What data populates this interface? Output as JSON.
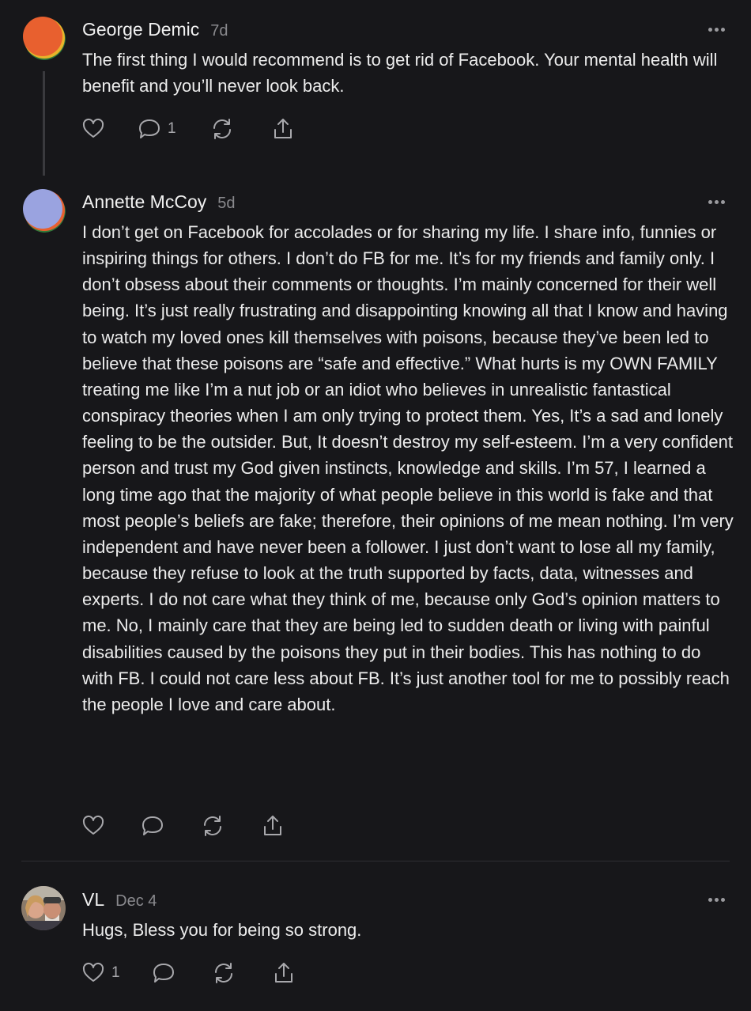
{
  "comments": [
    {
      "author": "George Demic",
      "age": "7d",
      "text": "The first thing I would recommend is to get rid of Facebook. Your mental health will benefit and you’ll never look back.",
      "reply_count": "1"
    },
    {
      "author": "Annette McCoy",
      "age": "5d",
      "text": "I don’t get on Facebook for accolades or for sharing my life. I share info, funnies or inspiring things for others. I don’t do FB for me. It’s for my friends and family only. I don’t obsess about their comments or thoughts. I’m mainly concerned for their well being. It’s just really frustrating and disappointing knowing all that I know and having to watch my loved ones kill themselves with poisons, because they’ve been led to believe that these poisons are “safe and effective.” What hurts is my OWN FAMILY treating me like I’m a nut job or an idiot who believes in unrealistic fantastical conspiracy theories when I am only trying to protect them. Yes, It’s a sad and lonely feeling to be the outsider. But, It doesn’t destroy my self-esteem. I’m a very confident person and trust my God given instincts, knowledge and skills. I’m 57, I learned a long time ago that the majority of what people believe in this world is fake and that most people’s beliefs are fake; therefore, their opinions of me mean nothing. I’m very independent and have never been a follower. I just don’t want to lose all my family, because they refuse to look at the truth supported by facts, data, witnesses and experts. I do not care what they think of me, because only God’s opinion matters to me. No, I mainly care that they are being led to sudden death or living with painful disabilities caused by the poisons they put in their bodies. This has nothing to do with FB. I could not care less about FB. It’s just another tool for me to possibly reach the people I love and care about."
    },
    {
      "author": "VL",
      "age": "Dec 4",
      "text": "Hugs, Bless you for being so strong.",
      "like_count": "1"
    }
  ],
  "icons": {
    "like": "heart-icon",
    "reply": "speech-bubble-icon",
    "restack": "restack-arrows-icon",
    "share": "share-upload-icon",
    "more": "ellipsis-icon"
  },
  "colors": {
    "background": "#17171a",
    "text": "#ececec",
    "muted": "#8a8a8e",
    "icon": "#a8a8ac"
  }
}
